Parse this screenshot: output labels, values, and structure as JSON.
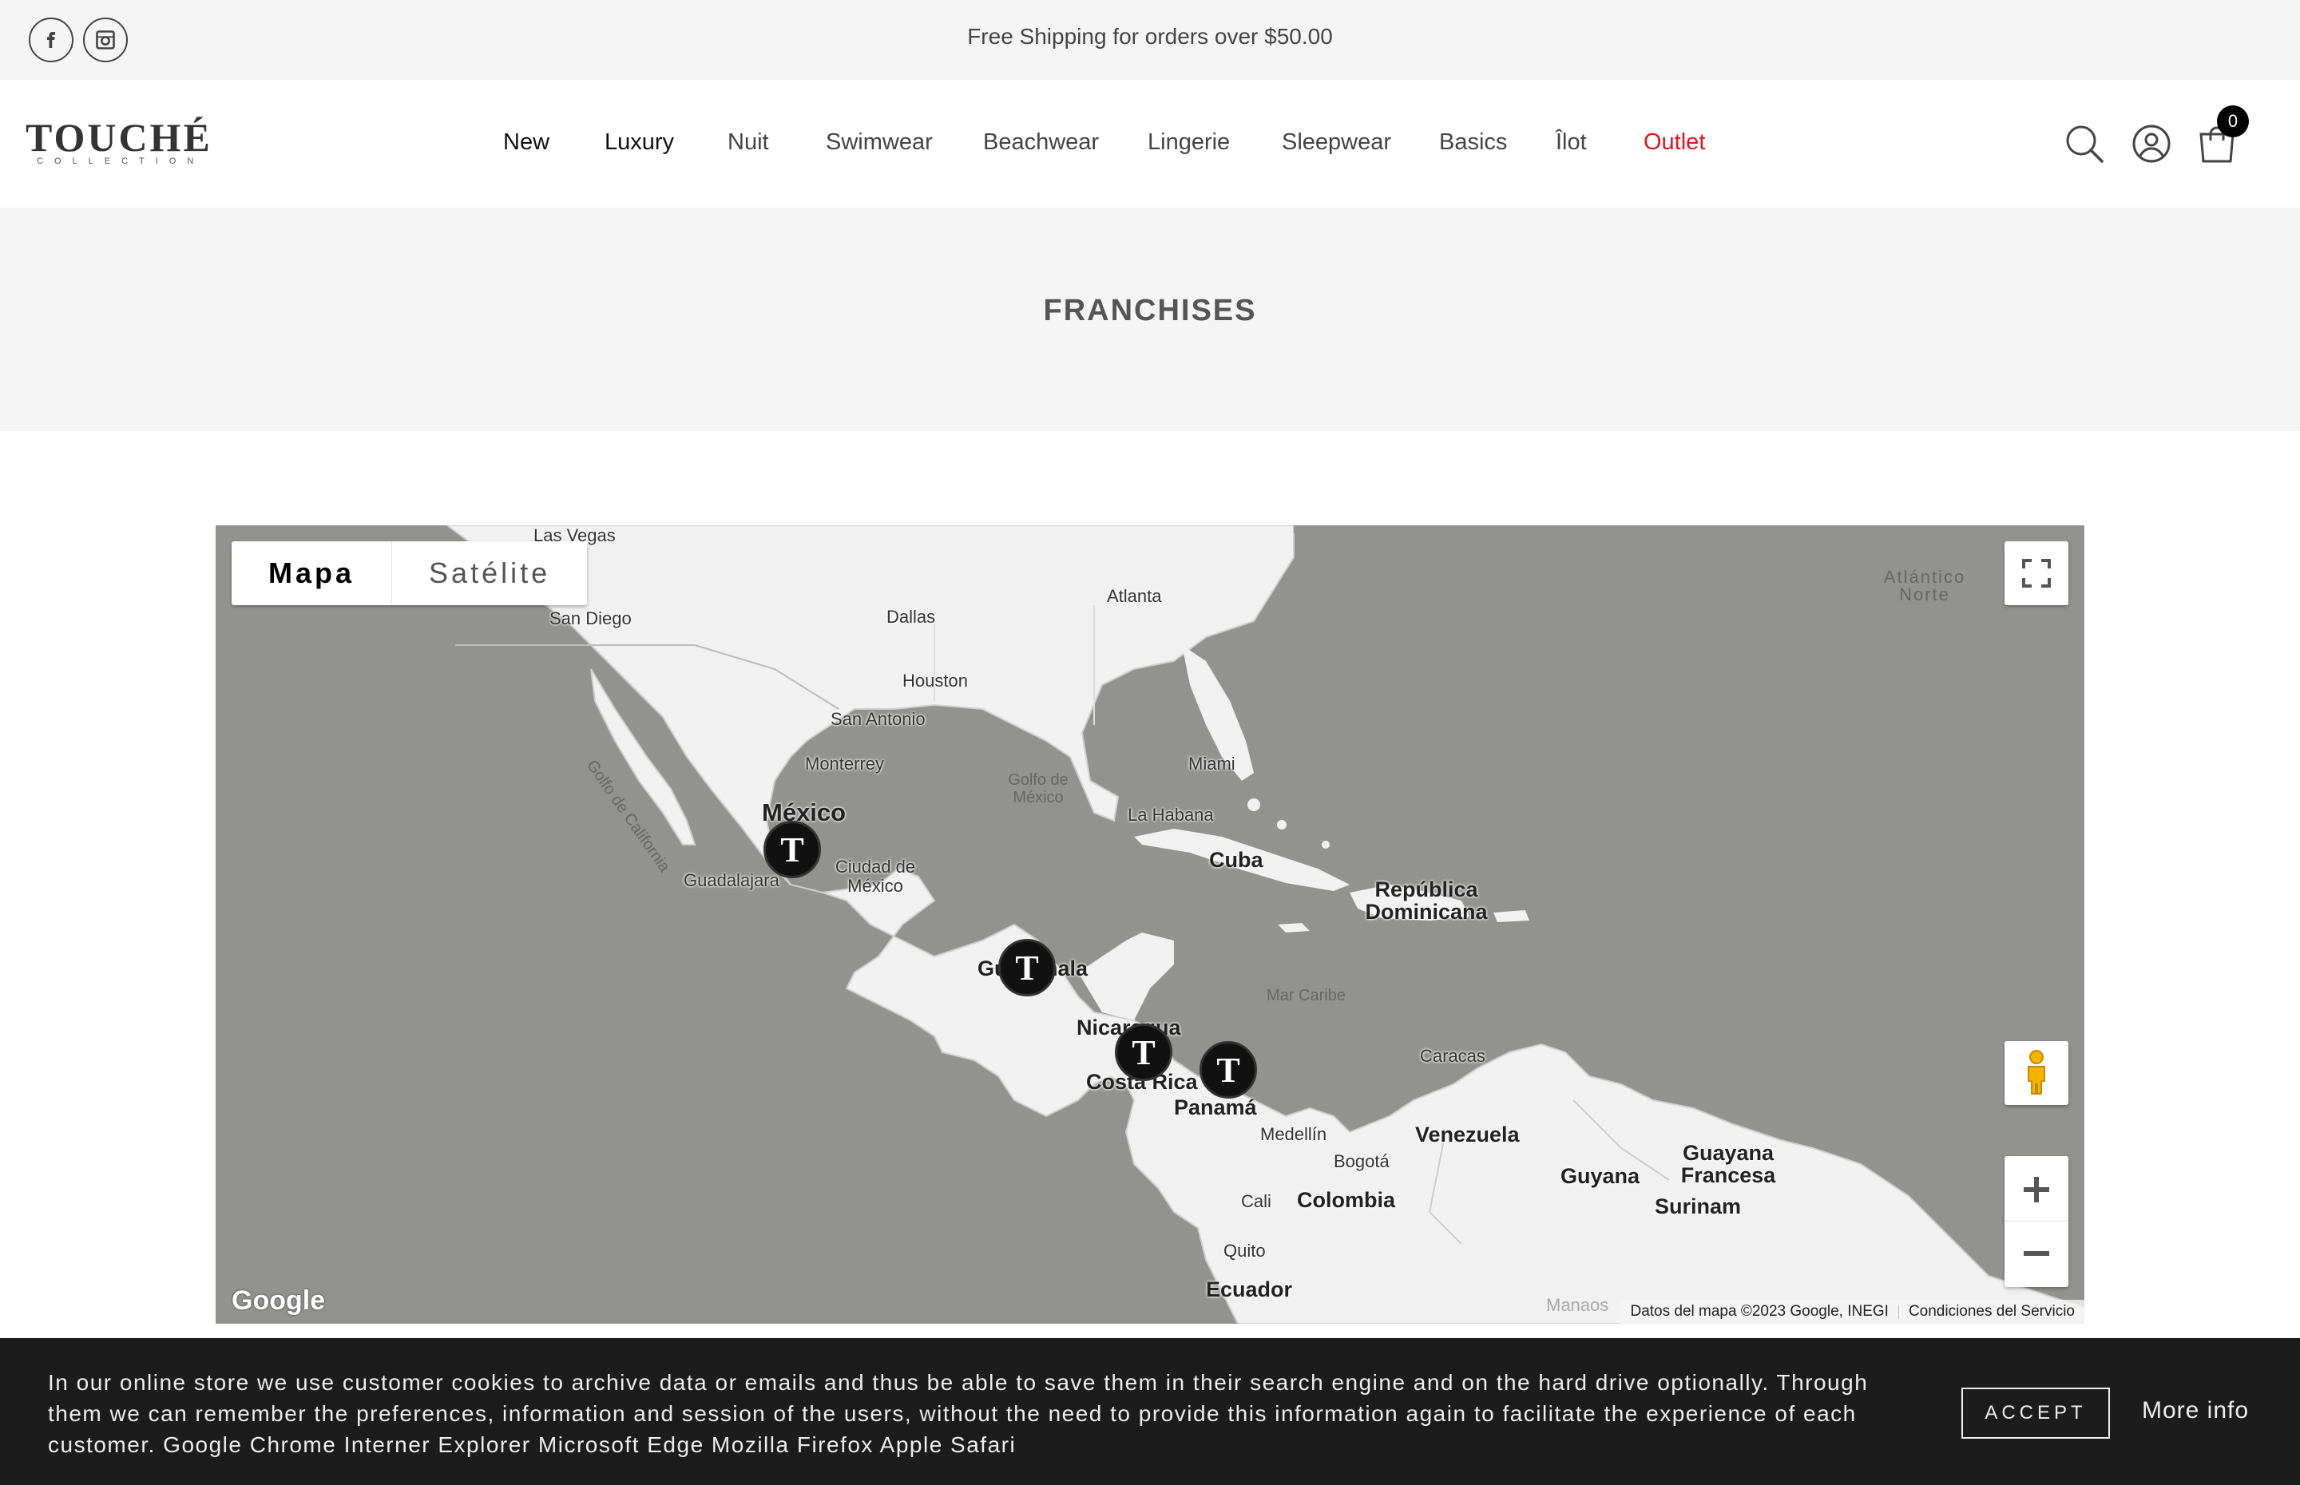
{
  "topbar": {
    "promo_text": "Free Shipping for orders over $50.00",
    "social": [
      {
        "icon": "facebook-icon"
      },
      {
        "icon": "instagram-icon"
      }
    ]
  },
  "header": {
    "logo_text": "TOUCHÉ",
    "logo_sub": "COLLECTION",
    "nav": [
      {
        "label": "New"
      },
      {
        "label": "Luxury"
      },
      {
        "label": "Nuit"
      },
      {
        "label": "Swimwear"
      },
      {
        "label": "Beachwear"
      },
      {
        "label": "Lingerie"
      },
      {
        "label": "Sleepwear"
      },
      {
        "label": "Basics"
      },
      {
        "label": "Îlot"
      },
      {
        "label": "Outlet",
        "color": "#e0161b"
      }
    ],
    "icons": [
      "search-icon",
      "account-icon",
      "cart-icon"
    ],
    "cart_count": "0"
  },
  "page": {
    "title": "FRANCHISES"
  },
  "map": {
    "type_buttons": {
      "map": "Mapa",
      "satellite": "Satélite"
    },
    "marker_glyph": "T",
    "labels": {
      "las_vegas": "Las Vegas",
      "san_diego": "San Diego",
      "dallas": "Dallas",
      "atlanta": "Atlanta",
      "houston": "Houston",
      "san_antonio": "San Antonio",
      "monterrey": "Monterrey",
      "golfo_california": "Golfo de California",
      "mexico": "México",
      "guadalajara": "Guadalajara",
      "ciudad_mexico": "Ciudad de México",
      "golfo_mexico": "Golfo de México",
      "miami": "Miami",
      "la_habana": "La Habana",
      "cuba": "Cuba",
      "republica_dominicana": "República Dominicana",
      "atlantico_norte": "Atlántico Norte",
      "guatemala": "Guatemala",
      "mar_caribe": "Mar Caribe",
      "nicaragua": "Nicaragua",
      "costa_rica": "Costa Rica",
      "panama": "Panamá",
      "caracas": "Caracas",
      "medellin": "Medellín",
      "venezuela": "Venezuela",
      "bogota": "Bogotá",
      "guyana": "Guyana",
      "guayana_francesa": "Guayana Francesa",
      "surinam": "Surinam",
      "cali": "Cali",
      "colombia": "Colombia",
      "quito": "Quito",
      "ecuador": "Ecuador",
      "manaos": "Manaos"
    },
    "google_logo": "Google",
    "attribution": "Datos del mapa ©2023 Google, INEGI",
    "terms": "Condiciones del Servicio",
    "controls": [
      "fullscreen-icon",
      "pegman-icon",
      "zoom-in-icon",
      "zoom-out-icon"
    ]
  },
  "cookie": {
    "text": "In our online store we use customer cookies to archive data or emails and thus be able to save them in their search engine and on the hard drive optionally. Through them we can remember the preferences, information and session of the users, without the need to provide this information again to facilitate the experience of each customer. Google Chrome Interner Explorer Microsoft Edge Mozilla Firefox Apple Safari",
    "accept_label": "ACCEPT",
    "more_info_label": "More info"
  }
}
